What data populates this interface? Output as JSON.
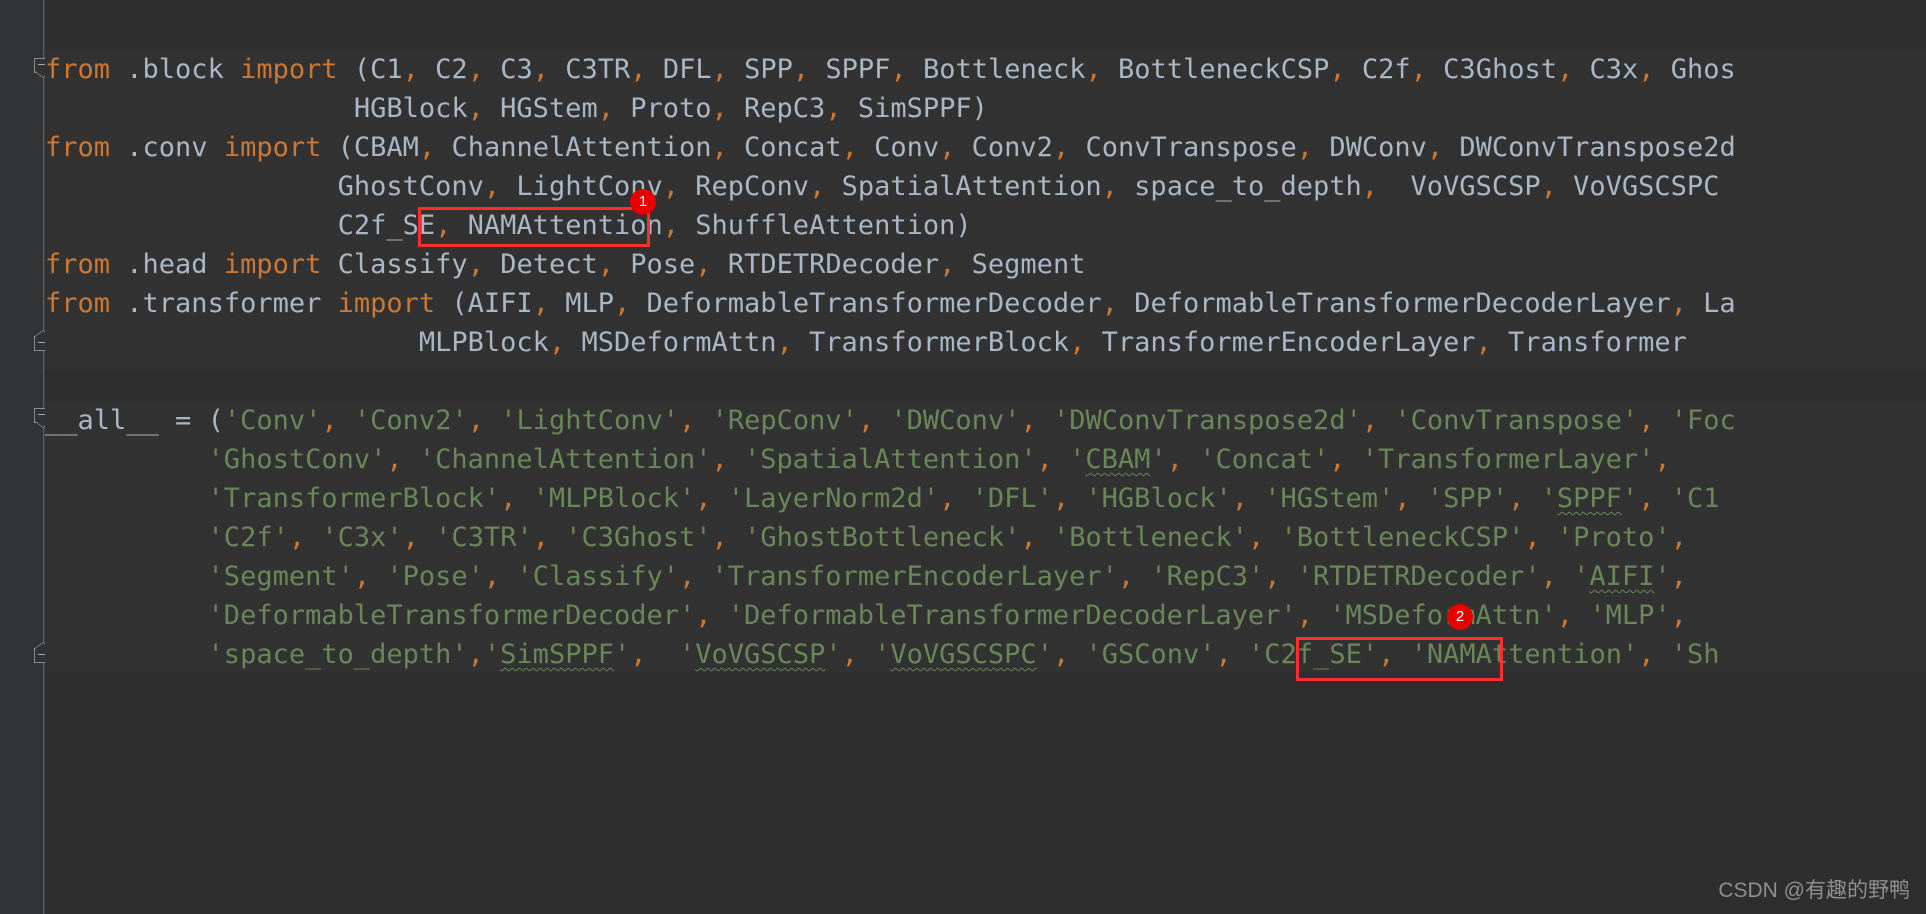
{
  "editor": {
    "theme_bg": "#2e2e2e",
    "gutter_bg": "#313335",
    "default_text_color": "#a9b7c6",
    "keyword_color": "#cc7832",
    "string_color": "#6a8759",
    "annotation_color": "#ff2e2e"
  },
  "code_lines": [
    {
      "id": "line-1",
      "text": "from .block import (C1, C2, C3, C3TR, DFL, SPP, SPPF, Bottleneck, BottleneckCSP, C2f, C3Ghost, C3x, Ghos",
      "tokens": [
        {
          "t": "from",
          "c": "kw"
        },
        {
          "t": " .block ",
          "c": "id"
        },
        {
          "t": "import",
          "c": "kw"
        },
        {
          "t": " (C1",
          "c": "id"
        },
        {
          "t": ",",
          "c": "punc"
        },
        {
          "t": " C2",
          "c": "id"
        },
        {
          "t": ",",
          "c": "punc"
        },
        {
          "t": " C3",
          "c": "id"
        },
        {
          "t": ",",
          "c": "punc"
        },
        {
          "t": " C3TR",
          "c": "id"
        },
        {
          "t": ",",
          "c": "punc"
        },
        {
          "t": " DFL",
          "c": "id"
        },
        {
          "t": ",",
          "c": "punc"
        },
        {
          "t": " SPP",
          "c": "id"
        },
        {
          "t": ",",
          "c": "punc"
        },
        {
          "t": " SPPF",
          "c": "id"
        },
        {
          "t": ",",
          "c": "punc"
        },
        {
          "t": " Bottleneck",
          "c": "id"
        },
        {
          "t": ",",
          "c": "punc"
        },
        {
          "t": " BottleneckCSP",
          "c": "id"
        },
        {
          "t": ",",
          "c": "punc"
        },
        {
          "t": " C2f",
          "c": "id"
        },
        {
          "t": ",",
          "c": "punc"
        },
        {
          "t": " C3Ghost",
          "c": "id"
        },
        {
          "t": ",",
          "c": "punc"
        },
        {
          "t": " C3x",
          "c": "id"
        },
        {
          "t": ",",
          "c": "punc"
        },
        {
          "t": " Ghos",
          "c": "id"
        }
      ]
    },
    {
      "id": "line-2",
      "text": "                   HGBlock, HGStem, Proto, RepC3, SimSPPF)",
      "tokens": [
        {
          "t": "                   HGBlock",
          "c": "id"
        },
        {
          "t": ",",
          "c": "punc"
        },
        {
          "t": " HGStem",
          "c": "id"
        },
        {
          "t": ",",
          "c": "punc"
        },
        {
          "t": " Proto",
          "c": "id"
        },
        {
          "t": ",",
          "c": "punc"
        },
        {
          "t": " RepC3",
          "c": "id"
        },
        {
          "t": ",",
          "c": "punc"
        },
        {
          "t": " SimSPPF)",
          "c": "id"
        }
      ]
    },
    {
      "id": "line-3",
      "text": "from .conv import (CBAM, ChannelAttention, Concat, Conv, Conv2, ConvTranspose, DWConv, DWConvTranspose2d",
      "tokens": [
        {
          "t": "from",
          "c": "kw"
        },
        {
          "t": " .conv ",
          "c": "id"
        },
        {
          "t": "import",
          "c": "kw"
        },
        {
          "t": " (CBAM",
          "c": "id"
        },
        {
          "t": ",",
          "c": "punc"
        },
        {
          "t": " ChannelAttention",
          "c": "id"
        },
        {
          "t": ",",
          "c": "punc"
        },
        {
          "t": " Concat",
          "c": "id"
        },
        {
          "t": ",",
          "c": "punc"
        },
        {
          "t": " Conv",
          "c": "id"
        },
        {
          "t": ",",
          "c": "punc"
        },
        {
          "t": " Conv2",
          "c": "id"
        },
        {
          "t": ",",
          "c": "punc"
        },
        {
          "t": " ConvTranspose",
          "c": "id"
        },
        {
          "t": ",",
          "c": "punc"
        },
        {
          "t": " DWConv",
          "c": "id"
        },
        {
          "t": ",",
          "c": "punc"
        },
        {
          "t": " DWConvTranspose2d",
          "c": "id"
        }
      ]
    },
    {
      "id": "line-4",
      "text": "                  GhostConv, LightConv, RepConv, SpatialAttention, space_to_depth,  VoVGSCSP, VoVGSCSPC",
      "tokens": [
        {
          "t": "                  GhostConv",
          "c": "id"
        },
        {
          "t": ",",
          "c": "punc"
        },
        {
          "t": " LightConv",
          "c": "id"
        },
        {
          "t": ",",
          "c": "punc"
        },
        {
          "t": " RepConv",
          "c": "id"
        },
        {
          "t": ",",
          "c": "punc"
        },
        {
          "t": " SpatialAttention",
          "c": "id"
        },
        {
          "t": ",",
          "c": "punc"
        },
        {
          "t": " space_to_depth",
          "c": "id"
        },
        {
          "t": ",",
          "c": "punc"
        },
        {
          "t": "  VoVGSCSP",
          "c": "id"
        },
        {
          "t": ",",
          "c": "punc"
        },
        {
          "t": " VoVGSCSPC",
          "c": "id"
        }
      ]
    },
    {
      "id": "line-5",
      "text": "                  C2f_SE, NAMAttention, ShuffleAttention)",
      "tokens": [
        {
          "t": "                  C2f_SE",
          "c": "id"
        },
        {
          "t": ",",
          "c": "punc"
        },
        {
          "t": " NAMAttention",
          "c": "id"
        },
        {
          "t": ",",
          "c": "punc"
        },
        {
          "t": " ShuffleAttention)",
          "c": "id"
        }
      ]
    },
    {
      "id": "line-6",
      "text": "from .head import Classify, Detect, Pose, RTDETRDecoder, Segment",
      "tokens": [
        {
          "t": "from",
          "c": "kw"
        },
        {
          "t": " .head ",
          "c": "id"
        },
        {
          "t": "import",
          "c": "kw"
        },
        {
          "t": " Classify",
          "c": "id"
        },
        {
          "t": ",",
          "c": "punc"
        },
        {
          "t": " Detect",
          "c": "id"
        },
        {
          "t": ",",
          "c": "punc"
        },
        {
          "t": " Pose",
          "c": "id"
        },
        {
          "t": ",",
          "c": "punc"
        },
        {
          "t": " RTDETRDecoder",
          "c": "id"
        },
        {
          "t": ",",
          "c": "punc"
        },
        {
          "t": " Segment",
          "c": "id"
        }
      ]
    },
    {
      "id": "line-7",
      "text": "from .transformer import (AIFI, MLP, DeformableTransformerDecoder, DeformableTransformerDecoderLayer, La",
      "tokens": [
        {
          "t": "from",
          "c": "kw"
        },
        {
          "t": " .transformer ",
          "c": "id"
        },
        {
          "t": "import",
          "c": "kw"
        },
        {
          "t": " (AIFI",
          "c": "id"
        },
        {
          "t": ",",
          "c": "punc"
        },
        {
          "t": " MLP",
          "c": "id"
        },
        {
          "t": ",",
          "c": "punc"
        },
        {
          "t": " DeformableTransformerDecoder",
          "c": "id"
        },
        {
          "t": ",",
          "c": "punc"
        },
        {
          "t": " DeformableTransformerDecoderLayer",
          "c": "id"
        },
        {
          "t": ",",
          "c": "punc"
        },
        {
          "t": " La",
          "c": "id"
        }
      ]
    },
    {
      "id": "line-8",
      "text": "                       MLPBlock, MSDeformAttn, TransformerBlock, TransformerEncoderLayer, Transformer",
      "tokens": [
        {
          "t": "                       MLPBlock",
          "c": "id"
        },
        {
          "t": ",",
          "c": "punc"
        },
        {
          "t": " MSDeformAttn",
          "c": "id"
        },
        {
          "t": ",",
          "c": "punc"
        },
        {
          "t": " TransformerBlock",
          "c": "id"
        },
        {
          "t": ",",
          "c": "punc"
        },
        {
          "t": " TransformerEncoderLayer",
          "c": "id"
        },
        {
          "t": ",",
          "c": "punc"
        },
        {
          "t": " Transformer",
          "c": "id"
        }
      ]
    },
    {
      "id": "line-9",
      "text": "__all__ = ('Conv', 'Conv2', 'LightConv', 'RepConv', 'DWConv', 'DWConvTranspose2d', 'ConvTranspose', 'Foc",
      "tokens": [
        {
          "t": "__all__",
          "c": "plain"
        },
        {
          "t": " = ",
          "c": "id"
        },
        {
          "t": "(",
          "c": "id"
        },
        {
          "t": "'Conv'",
          "c": "str"
        },
        {
          "t": ",",
          "c": "punc"
        },
        {
          "t": " 'Conv2'",
          "c": "str"
        },
        {
          "t": ",",
          "c": "punc"
        },
        {
          "t": " 'LightConv'",
          "c": "str"
        },
        {
          "t": ",",
          "c": "punc"
        },
        {
          "t": " 'RepConv'",
          "c": "str"
        },
        {
          "t": ",",
          "c": "punc"
        },
        {
          "t": " 'DWConv'",
          "c": "str"
        },
        {
          "t": ",",
          "c": "punc"
        },
        {
          "t": " 'DWConvTranspose2d'",
          "c": "str"
        },
        {
          "t": ",",
          "c": "punc"
        },
        {
          "t": " 'ConvTranspose'",
          "c": "str"
        },
        {
          "t": ",",
          "c": "punc"
        },
        {
          "t": " 'Foc",
          "c": "str"
        }
      ]
    },
    {
      "id": "line-10",
      "text": "          'GhostConv', 'ChannelAttention', 'SpatialAttention', 'CBAM', 'Concat', 'TransformerLayer',",
      "tokens": [
        {
          "t": "          'GhostConv'",
          "c": "str"
        },
        {
          "t": ",",
          "c": "punc"
        },
        {
          "t": " 'ChannelAttention'",
          "c": "str"
        },
        {
          "t": ",",
          "c": "punc"
        },
        {
          "t": " 'SpatialAttention'",
          "c": "str"
        },
        {
          "t": ",",
          "c": "punc"
        },
        {
          "t": " '",
          "c": "str"
        },
        {
          "t": "CBAM",
          "c": "str spell"
        },
        {
          "t": "'",
          "c": "str"
        },
        {
          "t": ",",
          "c": "punc"
        },
        {
          "t": " 'Concat'",
          "c": "str"
        },
        {
          "t": ",",
          "c": "punc"
        },
        {
          "t": " 'TransformerLayer'",
          "c": "str"
        },
        {
          "t": ",",
          "c": "punc"
        }
      ]
    },
    {
      "id": "line-11",
      "text": "          'TransformerBlock', 'MLPBlock', 'LayerNorm2d', 'DFL', 'HGBlock', 'HGStem', 'SPP', 'SPPF', 'C1",
      "tokens": [
        {
          "t": "          'TransformerBlock'",
          "c": "str"
        },
        {
          "t": ",",
          "c": "punc"
        },
        {
          "t": " 'MLPBlock'",
          "c": "str"
        },
        {
          "t": ",",
          "c": "punc"
        },
        {
          "t": " 'LayerNorm2d'",
          "c": "str"
        },
        {
          "t": ",",
          "c": "punc"
        },
        {
          "t": " 'DFL'",
          "c": "str"
        },
        {
          "t": ",",
          "c": "punc"
        },
        {
          "t": " 'HGBlock'",
          "c": "str"
        },
        {
          "t": ",",
          "c": "punc"
        },
        {
          "t": " 'HGStem'",
          "c": "str"
        },
        {
          "t": ",",
          "c": "punc"
        },
        {
          "t": " 'SPP'",
          "c": "str"
        },
        {
          "t": ",",
          "c": "punc"
        },
        {
          "t": " '",
          "c": "str"
        },
        {
          "t": "SPPF",
          "c": "str spell"
        },
        {
          "t": "'",
          "c": "str"
        },
        {
          "t": ",",
          "c": "punc"
        },
        {
          "t": " 'C1",
          "c": "str"
        }
      ]
    },
    {
      "id": "line-12",
      "text": "          'C2f', 'C3x', 'C3TR', 'C3Ghost', 'GhostBottleneck', 'Bottleneck', 'BottleneckCSP', 'Proto',",
      "tokens": [
        {
          "t": "          'C2f'",
          "c": "str"
        },
        {
          "t": ",",
          "c": "punc"
        },
        {
          "t": " 'C3x'",
          "c": "str"
        },
        {
          "t": ",",
          "c": "punc"
        },
        {
          "t": " 'C3TR'",
          "c": "str"
        },
        {
          "t": ",",
          "c": "punc"
        },
        {
          "t": " 'C3Ghost'",
          "c": "str"
        },
        {
          "t": ",",
          "c": "punc"
        },
        {
          "t": " 'GhostBottleneck'",
          "c": "str"
        },
        {
          "t": ",",
          "c": "punc"
        },
        {
          "t": " 'Bottleneck'",
          "c": "str"
        },
        {
          "t": ",",
          "c": "punc"
        },
        {
          "t": " 'BottleneckCSP'",
          "c": "str"
        },
        {
          "t": ",",
          "c": "punc"
        },
        {
          "t": " 'Proto'",
          "c": "str"
        },
        {
          "t": ",",
          "c": "punc"
        }
      ]
    },
    {
      "id": "line-13",
      "text": "          'Segment', 'Pose', 'Classify', 'TransformerEncoderLayer', 'RepC3', 'RTDETRDecoder', 'AIFI',",
      "tokens": [
        {
          "t": "          'Segment'",
          "c": "str"
        },
        {
          "t": ",",
          "c": "punc"
        },
        {
          "t": " 'Pose'",
          "c": "str"
        },
        {
          "t": ",",
          "c": "punc"
        },
        {
          "t": " 'Classify'",
          "c": "str"
        },
        {
          "t": ",",
          "c": "punc"
        },
        {
          "t": " 'TransformerEncoderLayer'",
          "c": "str"
        },
        {
          "t": ",",
          "c": "punc"
        },
        {
          "t": " 'RepC3'",
          "c": "str"
        },
        {
          "t": ",",
          "c": "punc"
        },
        {
          "t": " 'RTDETRDecoder'",
          "c": "str"
        },
        {
          "t": ",",
          "c": "punc"
        },
        {
          "t": " '",
          "c": "str"
        },
        {
          "t": "AIFI",
          "c": "str spell"
        },
        {
          "t": "'",
          "c": "str"
        },
        {
          "t": ",",
          "c": "punc"
        }
      ]
    },
    {
      "id": "line-14",
      "text": "          'DeformableTransformerDecoder', 'DeformableTransformerDecoderLayer', 'MSDeformAttn', 'MLP',",
      "tokens": [
        {
          "t": "          'DeformableTransformerDecoder'",
          "c": "str"
        },
        {
          "t": ",",
          "c": "punc"
        },
        {
          "t": " 'DeformableTransformerDecoderLayer'",
          "c": "str"
        },
        {
          "t": ",",
          "c": "punc"
        },
        {
          "t": " 'MSDeformAttn'",
          "c": "str"
        },
        {
          "t": ",",
          "c": "punc"
        },
        {
          "t": " 'MLP'",
          "c": "str"
        },
        {
          "t": ",",
          "c": "punc"
        }
      ]
    },
    {
      "id": "line-15",
      "text": "          'space_to_depth','SimSPPF',  'VoVGSCSP', 'VoVGSCSPC', 'GSConv', 'C2f_SE', 'NAMAttention', 'Sh",
      "tokens": [
        {
          "t": "          'space_to_depth'",
          "c": "str"
        },
        {
          "t": ",",
          "c": "punc"
        },
        {
          "t": "'",
          "c": "str"
        },
        {
          "t": "SimSPPF",
          "c": "str spell"
        },
        {
          "t": "'",
          "c": "str"
        },
        {
          "t": ",",
          "c": "punc"
        },
        {
          "t": "  '",
          "c": "str"
        },
        {
          "t": "VoVGSCSP",
          "c": "str spell"
        },
        {
          "t": "'",
          "c": "str"
        },
        {
          "t": ",",
          "c": "punc"
        },
        {
          "t": " '",
          "c": "str"
        },
        {
          "t": "VoVGSCSPC",
          "c": "str spell"
        },
        {
          "t": "'",
          "c": "str"
        },
        {
          "t": ",",
          "c": "punc"
        },
        {
          "t": " 'GSConv'",
          "c": "str"
        },
        {
          "t": ",",
          "c": "punc"
        },
        {
          "t": " 'C2f_SE'",
          "c": "str"
        },
        {
          "t": ",",
          "c": "punc"
        },
        {
          "t": " 'NAMAttention'",
          "c": "str"
        },
        {
          "t": ",",
          "c": "punc"
        },
        {
          "t": " 'Sh",
          "c": "str"
        }
      ]
    }
  ],
  "annotations": {
    "box_1": {
      "label": "NAMAttention"
    },
    "box_2": {
      "label": "'NAMAttention'"
    },
    "badge_1": "1",
    "badge_2": "2"
  },
  "watermark": {
    "text": "CSDN @有趣的野鸭"
  }
}
